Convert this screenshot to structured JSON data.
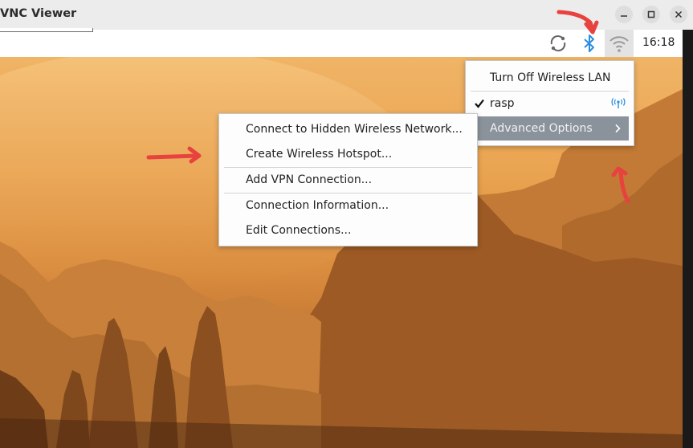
{
  "window": {
    "title": "VNC Viewer",
    "controls": [
      "minimize",
      "maximize",
      "close"
    ]
  },
  "taskbar": {
    "clock": "16:18",
    "icons": [
      "sync-icon",
      "bluetooth-icon",
      "wifi-icon"
    ]
  },
  "network_menu": {
    "items": [
      {
        "label": "Turn Off Wireless LAN"
      },
      {
        "label": "rasp",
        "checked": true,
        "icon": "wireless-signal-icon"
      },
      {
        "label": "Advanced Options",
        "highlighted": true,
        "submenu": true
      }
    ]
  },
  "advanced_submenu": {
    "items": [
      {
        "label": "Connect to Hidden Wireless Network..."
      },
      {
        "label": "Create Wireless Hotspot..."
      },
      {
        "label": "Add VPN Connection..."
      },
      {
        "label": "Connection Information..."
      },
      {
        "label": "Edit Connections..."
      }
    ]
  },
  "colors": {
    "highlight": "#8a929c",
    "annotation": "#e8423f",
    "bluetooth": "#2a8de0"
  }
}
